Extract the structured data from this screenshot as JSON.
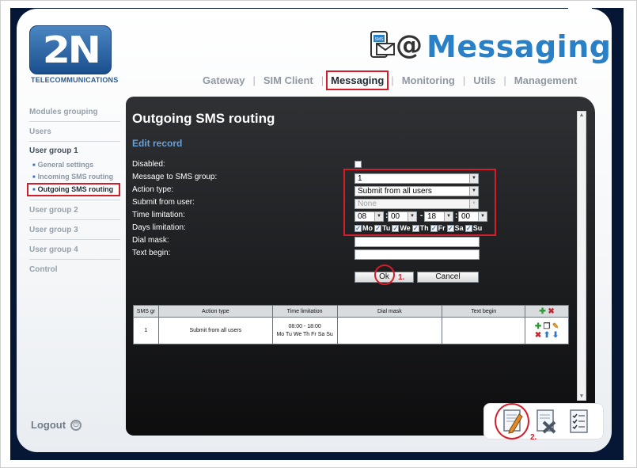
{
  "brand": {
    "logo": "2N",
    "subtitle": "TELECOMMUNICATIONS"
  },
  "header": {
    "title": "Messaging",
    "icon": "sms-at-icon"
  },
  "nav": [
    "Gateway",
    "SIM Client",
    "Messaging",
    "Monitoring",
    "Utils",
    "Management"
  ],
  "nav_active": "Messaging",
  "sidebar": {
    "modules_grouping": "Modules grouping",
    "users": "Users",
    "user_group_1": "User group 1",
    "general_settings": "General settings",
    "incoming_sms_routing": "Incoming SMS routing",
    "outgoing_sms_routing": "Outgoing SMS routing",
    "user_group_2": "User group 2",
    "user_group_3": "User group 3",
    "user_group_4": "User group 4",
    "control": "Control",
    "logout": "Logout"
  },
  "page": {
    "title": "Outgoing SMS routing",
    "section": "Edit record"
  },
  "form": {
    "disabled_label": "Disabled:",
    "group_label": "Message to SMS group:",
    "group_value": "1",
    "action_label": "Action type:",
    "action_value": "Submit from all users",
    "user_label": "Submit from user:",
    "user_value": "None",
    "time_label": "Time limitation:",
    "time_from_h": "08",
    "time_from_m": "00",
    "time_to_h": "18",
    "time_to_m": "00",
    "days_label": "Days limitation:",
    "days": [
      "Mo",
      "Tu",
      "We",
      "Th",
      "Fr",
      "Sa",
      "Su"
    ],
    "dial_label": "Dial mask:",
    "text_label": "Text begin:",
    "ok": "Ok",
    "cancel": "Cancel",
    "mark1": "1.",
    "mark2": "2."
  },
  "table": {
    "headers": [
      "SMS gr",
      "Action type",
      "Time limitation",
      "Dial mask",
      "Text begin"
    ],
    "rows": [
      {
        "group": "1",
        "action": "Submit from all users",
        "time": "08:00 - 18:00",
        "days": "Mo Tu We Th Fr Sa Su"
      }
    ]
  }
}
